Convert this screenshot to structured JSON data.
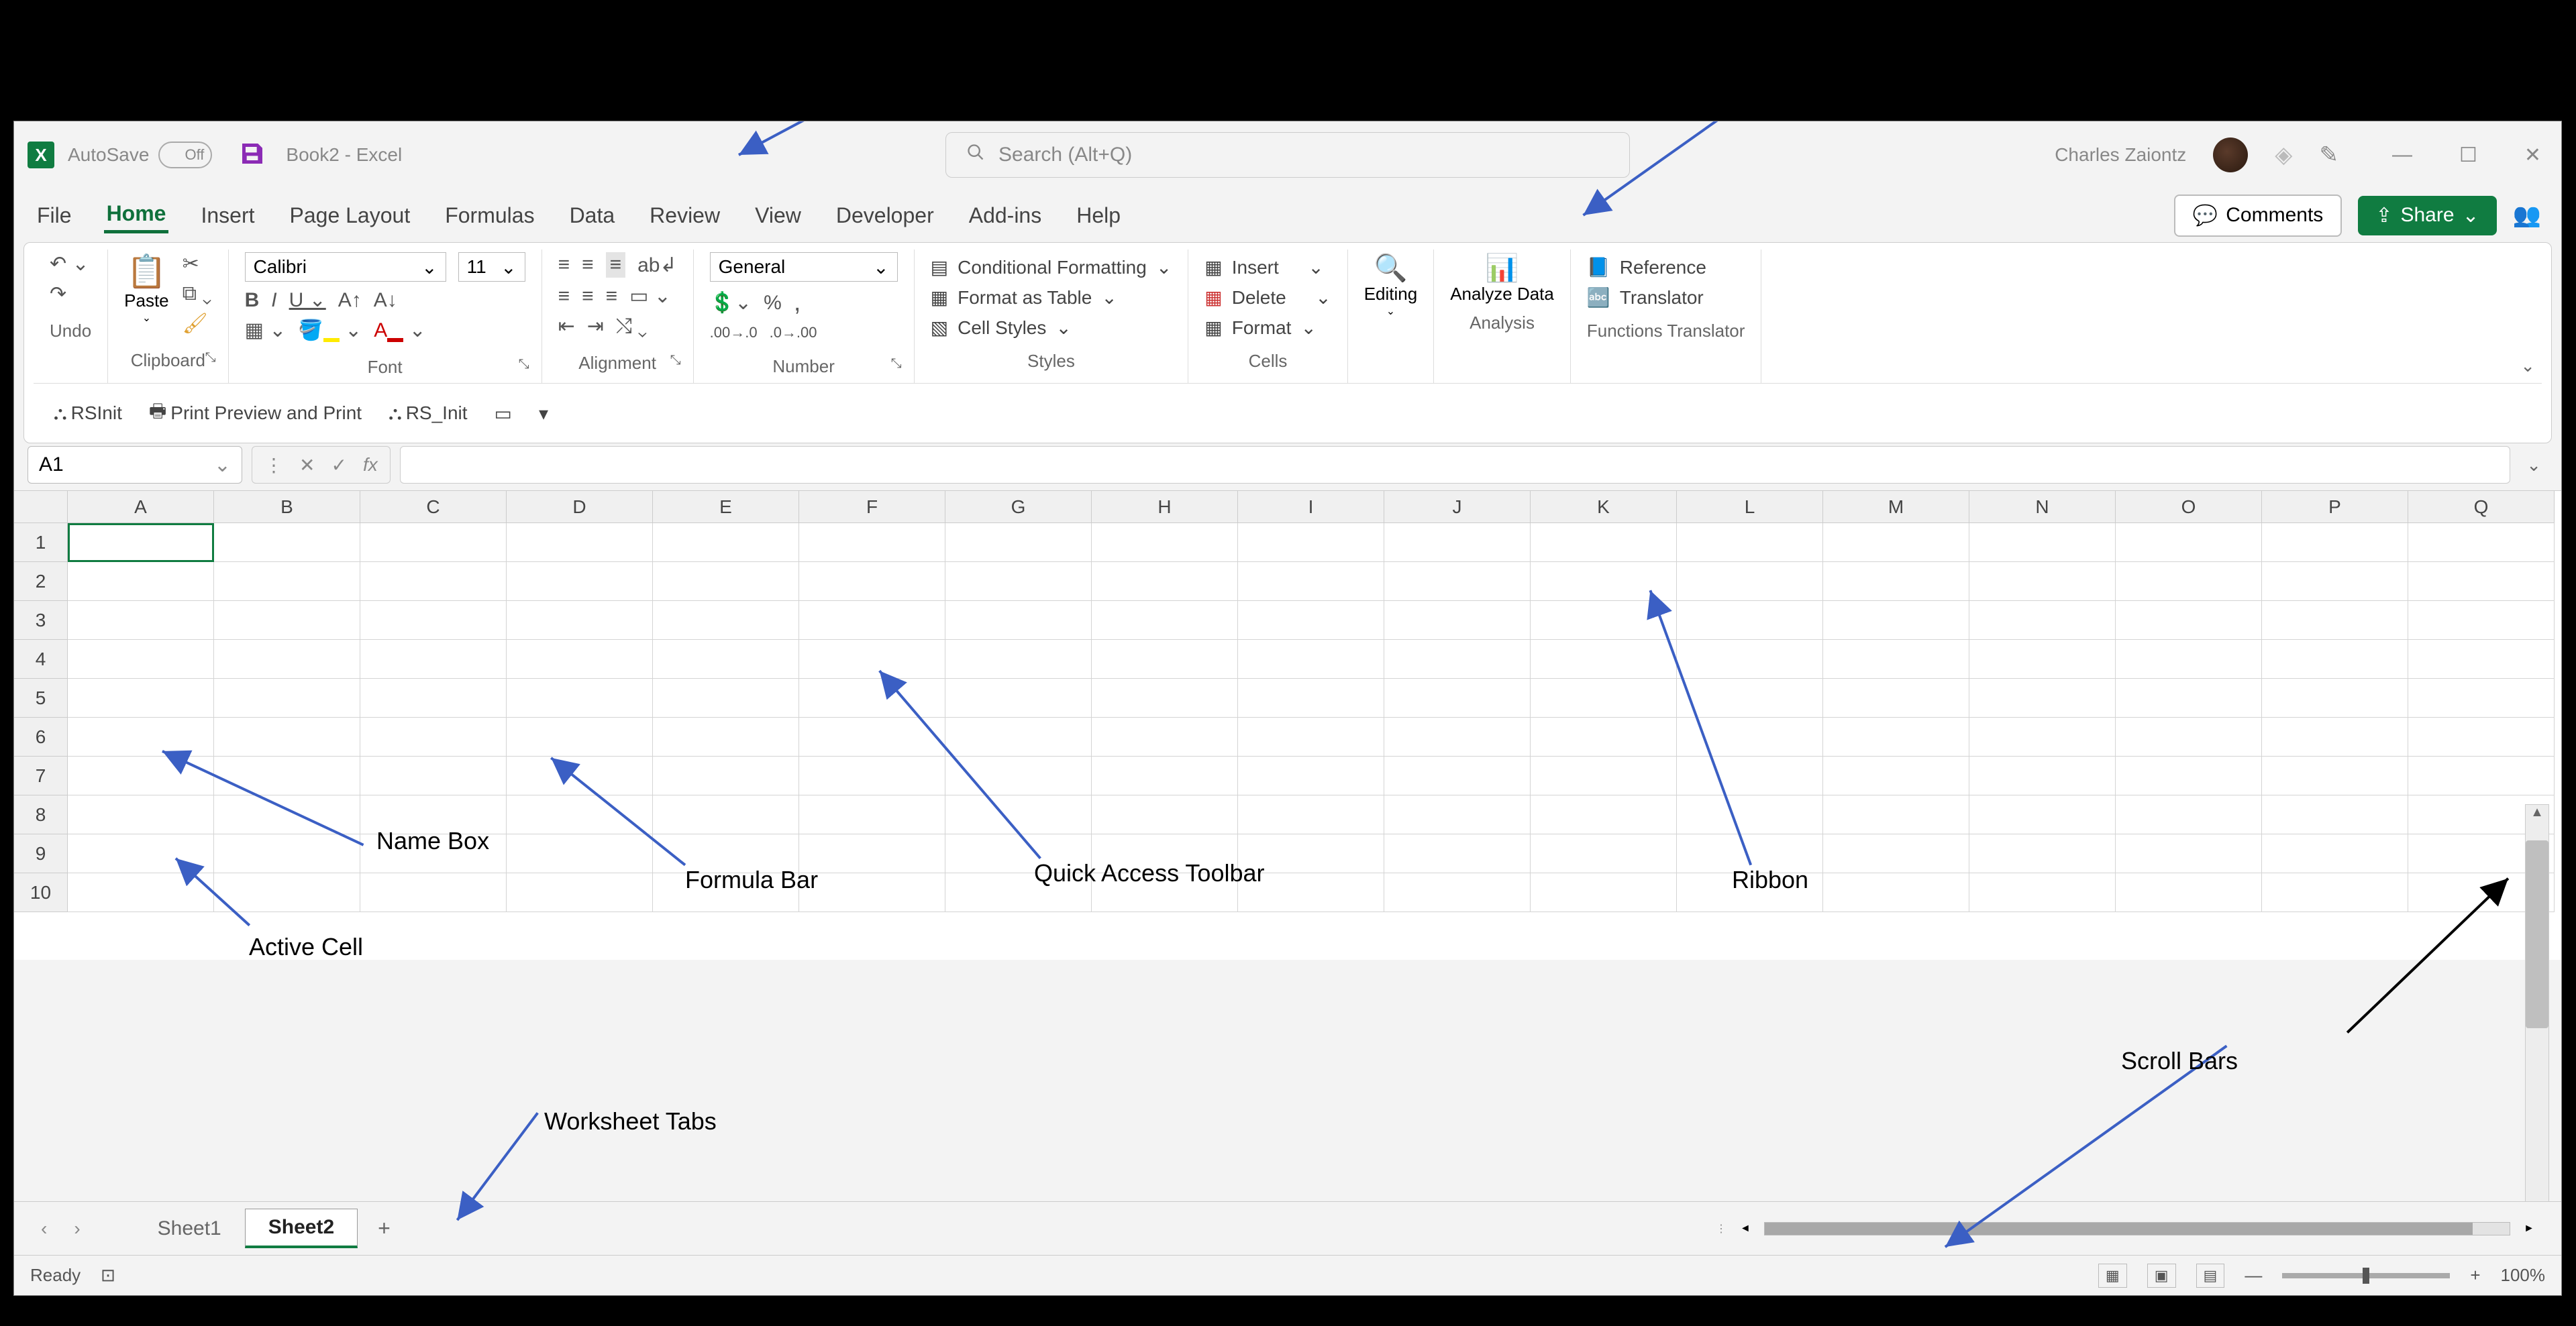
{
  "title": {
    "autosave_label": "AutoSave",
    "autosave_state": "Off",
    "doc": "Book2  -  Excel",
    "search_placeholder": "Search (Alt+Q)",
    "user": "Charles Zaiontz"
  },
  "tabs": [
    "File",
    "Home",
    "Insert",
    "Page Layout",
    "Formulas",
    "Data",
    "Review",
    "View",
    "Developer",
    "Add-ins",
    "Help"
  ],
  "active_tab": "Home",
  "comments_label": "Comments",
  "share_label": "Share",
  "ribbon": {
    "undo": {
      "label": "Undo"
    },
    "clipboard": {
      "label": "Clipboard",
      "paste": "Paste"
    },
    "font": {
      "label": "Font",
      "name": "Calibri",
      "size": "11"
    },
    "alignment": {
      "label": "Alignment"
    },
    "number": {
      "label": "Number",
      "format": "General"
    },
    "styles": {
      "label": "Styles",
      "cond": "Conditional Formatting",
      "fat": "Format as Table",
      "cs": "Cell Styles"
    },
    "cells": {
      "label": "Cells",
      "ins": "Insert",
      "del": "Delete",
      "fmt": "Format"
    },
    "editing": {
      "label": "Editing"
    },
    "analysis": {
      "label": "Analysis",
      "ad": "Analyze Data"
    },
    "ft": {
      "label": "Functions Translator",
      "ref": "Reference",
      "tr": "Translator"
    }
  },
  "qat": {
    "b1": "RSInit",
    "b2": "Print Preview and Print",
    "b3": "RS_Init"
  },
  "name_box": "A1",
  "columns": [
    "A",
    "B",
    "C",
    "D",
    "E",
    "F",
    "G",
    "H",
    "I",
    "J",
    "K",
    "L",
    "M",
    "N",
    "O",
    "P",
    "Q"
  ],
  "rows": [
    "1",
    "2",
    "3",
    "4",
    "5",
    "6",
    "7",
    "8",
    "9",
    "10"
  ],
  "annotations": {
    "nb": "Name Box",
    "fb": "Formula Bar",
    "qat": "Quick Access Toolbar",
    "rb": "Ribbon",
    "ac": "Active Cell",
    "wt": "Worksheet Tabs",
    "sb": "Scroll Bars"
  },
  "sheets": {
    "s1": "Sheet1",
    "s2": "Sheet2"
  },
  "status": {
    "ready": "Ready",
    "zoom": "100%"
  }
}
